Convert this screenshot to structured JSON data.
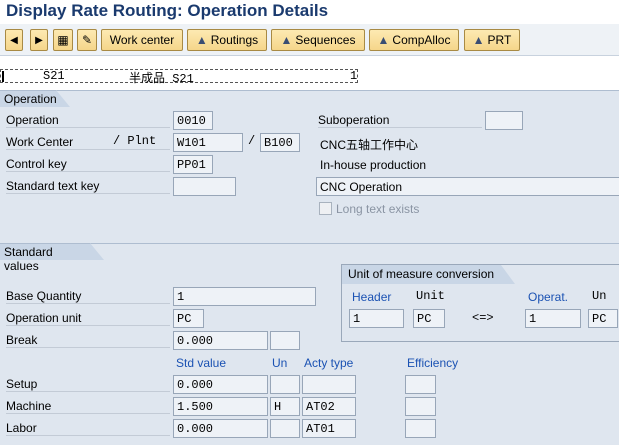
{
  "window": {
    "title": "Display Rate Routing: Operation Details"
  },
  "toolbar": {
    "prev_icon": "triangle-left-icon",
    "next_icon": "triangle-right-icon",
    "overview_icon": "overview-icon",
    "edit_icon": "pencil-icon",
    "buttons": [
      "Work center",
      "Routings",
      "Sequences",
      "CompAlloc",
      "PRT"
    ]
  },
  "header_row": {
    "material": "S21",
    "description": "半成品 S21",
    "counter": "1"
  },
  "operation": {
    "section_title": "Operation",
    "operation_label": "Operation",
    "operation_value": "0010",
    "work_center_label": "Work Center",
    "plant_label": "/ Plnt",
    "work_center_value": "W101",
    "plant_sep": "/",
    "plant_value": "B100",
    "work_center_desc": "CNC五轴工作中心",
    "control_key_label": "Control key",
    "control_key_value": "PP01",
    "control_key_desc": "In-house production",
    "std_text_label": "Standard text key",
    "std_text_value": "",
    "operation_desc": "CNC Operation",
    "suboperation_label": "Suboperation",
    "suboperation_value": "",
    "long_text_label": "Long text exists"
  },
  "standard_values": {
    "section_title": "Standard values",
    "base_qty_label": "Base Quantity",
    "base_qty_value": "1",
    "op_unit_label": "Operation unit",
    "op_unit_value": "PC",
    "break_label": "Break",
    "break_value": "0.000",
    "col_std_value": "Std value",
    "col_un": "Un",
    "col_acty": "Acty type",
    "col_eff": "Efficiency",
    "rows": [
      {
        "label": "Setup",
        "value": "0.000",
        "unit": "",
        "acty": ""
      },
      {
        "label": "Machine",
        "value": "1.500",
        "unit": "H",
        "acty": "AT02"
      },
      {
        "label": "Labor",
        "value": "0.000",
        "unit": "",
        "acty": "AT01"
      }
    ]
  },
  "uom_conversion": {
    "title": "Unit of measure conversion",
    "header_label": "Header",
    "unit_label": "Unit",
    "operat_label": "Operat.",
    "un_label": "Un",
    "header_value": "1",
    "header_unit": "PC",
    "arrow": "<=>",
    "operat_value": "1",
    "operat_unit": "PC"
  },
  "colors": {
    "background": "#dfe6ef",
    "title_text": "#1a3a6e",
    "accent_blue": "#1b52b3",
    "button_fill": "#f5d68a"
  }
}
